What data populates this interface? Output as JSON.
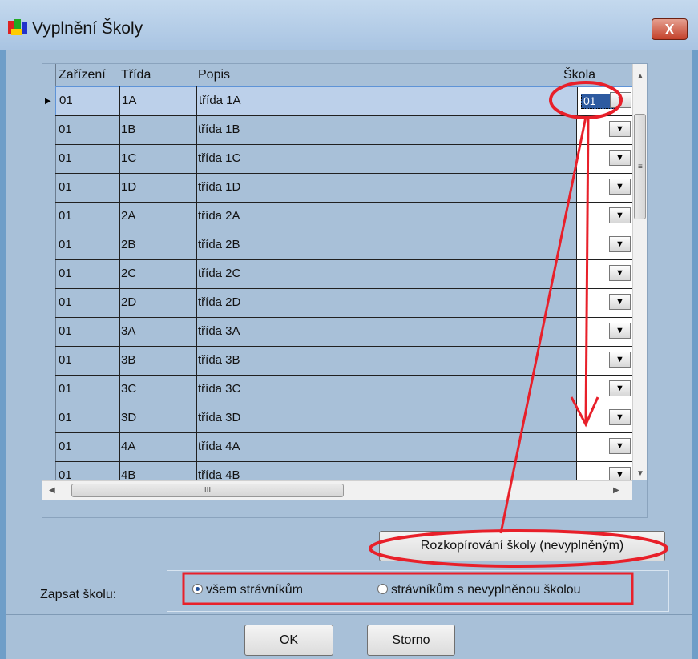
{
  "window": {
    "title": "Vyplnění Školy",
    "close_label": "X"
  },
  "grid": {
    "columns": [
      "Zařízení",
      "Třída",
      "Popis",
      "Škola"
    ],
    "selected_school": "01",
    "rows": [
      {
        "zarizeni": "01",
        "trida": "1A",
        "popis": "třída 1A"
      },
      {
        "zarizeni": "01",
        "trida": "1B",
        "popis": "třída 1B"
      },
      {
        "zarizeni": "01",
        "trida": "1C",
        "popis": "třída 1C"
      },
      {
        "zarizeni": "01",
        "trida": "1D",
        "popis": "třída 1D"
      },
      {
        "zarizeni": "01",
        "trida": "2A",
        "popis": "třída 2A"
      },
      {
        "zarizeni": "01",
        "trida": "2B",
        "popis": "třída 2B"
      },
      {
        "zarizeni": "01",
        "trida": "2C",
        "popis": "třída 2C"
      },
      {
        "zarizeni": "01",
        "trida": "2D",
        "popis": "třída 2D"
      },
      {
        "zarizeni": "01",
        "trida": "3A",
        "popis": "třída 3A"
      },
      {
        "zarizeni": "01",
        "trida": "3B",
        "popis": "třída 3B"
      },
      {
        "zarizeni": "01",
        "trida": "3C",
        "popis": "třída 3C"
      },
      {
        "zarizeni": "01",
        "trida": "3D",
        "popis": "třída 3D"
      },
      {
        "zarizeni": "01",
        "trida": "4A",
        "popis": "třída 4A"
      },
      {
        "zarizeni": "01",
        "trida": "4B",
        "popis": "třída 4B"
      }
    ]
  },
  "scrollbar": {
    "hgrip": "III",
    "vgrip": "≡"
  },
  "copy_button": "Rozkopírování školy (nevyplněným)",
  "zapsat": {
    "label": "Zapsat školu:",
    "option1": "všem strávníkům",
    "option2": "strávníkům s nevyplněnou školou",
    "selected": "option1"
  },
  "buttons": {
    "ok": "OK",
    "storno": "Storno"
  },
  "colors": {
    "annotation": "#e8202a",
    "title_bg": "#b7cee8",
    "grid_bg": "#a8c0d8"
  }
}
